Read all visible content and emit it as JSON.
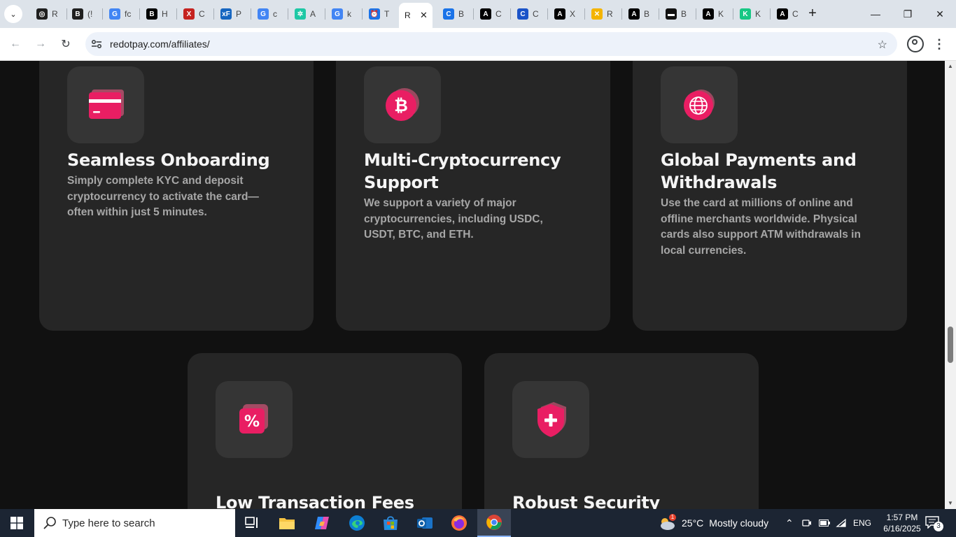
{
  "browser": {
    "tabs": [
      {
        "short": "R",
        "fav_color": "#1f1f1f",
        "fav_glyph": "◎"
      },
      {
        "short": "(!",
        "fav_color": "#1f1f1f",
        "fav_glyph": "B"
      },
      {
        "short": "fc",
        "fav_color": "#4285f4",
        "fav_glyph": "G"
      },
      {
        "short": "H",
        "fav_color": "#000000",
        "fav_glyph": "B"
      },
      {
        "short": "C",
        "fav_color": "#c5221f",
        "fav_glyph": "X"
      },
      {
        "short": "P",
        "fav_color": "#1565c0",
        "fav_glyph": "xF"
      },
      {
        "short": "c",
        "fav_color": "#4285f4",
        "fav_glyph": "G"
      },
      {
        "short": "A",
        "fav_color": "#1ec8a5",
        "fav_glyph": "✲"
      },
      {
        "short": "k",
        "fav_color": "#4285f4",
        "fav_glyph": "G"
      },
      {
        "short": "T",
        "fav_color": "#1a73e8",
        "fav_glyph": "⏰"
      },
      {
        "short": "R",
        "fav_color": "#ffffff",
        "fav_glyph": "",
        "active": true
      },
      {
        "short": "B",
        "fav_color": "#1a73e8",
        "fav_glyph": "C"
      },
      {
        "short": "C",
        "fav_color": "#000000",
        "fav_glyph": "A"
      },
      {
        "short": "C",
        "fav_color": "#1a53c8",
        "fav_glyph": "C"
      },
      {
        "short": "X",
        "fav_color": "#000000",
        "fav_glyph": "A"
      },
      {
        "short": "R",
        "fav_color": "#f4b400",
        "fav_glyph": "✕"
      },
      {
        "short": "B",
        "fav_color": "#000000",
        "fav_glyph": "A"
      },
      {
        "short": "B",
        "fav_color": "#111111",
        "fav_glyph": "▬"
      },
      {
        "short": "K",
        "fav_color": "#000000",
        "fav_glyph": "A"
      },
      {
        "short": "K",
        "fav_color": "#16c784",
        "fav_glyph": "K"
      },
      {
        "short": "C",
        "fav_color": "#000000",
        "fav_glyph": "A"
      }
    ],
    "address": "redotpay.com/affiliates/"
  },
  "page": {
    "cards": [
      {
        "title": "Seamless Onboarding",
        "desc": "Simply complete KYC and deposit cryptocurrency to activate the card—often within just 5 minutes.",
        "icon": "credit-card-icon"
      },
      {
        "title": "Multi-Cryptocurrency Support",
        "desc": "We support a variety of major cryptocurrencies, including USDC, USDT, BTC, and ETH.",
        "icon": "bitcoin-icon"
      },
      {
        "title": "Global Payments and Withdrawals",
        "desc": "Use the card at millions of online and offline merchants worldwide. Physical cards also support ATM withdrawals in local currencies.",
        "icon": "globe-icon"
      },
      {
        "title": "Low Transaction Fees",
        "desc": "",
        "icon": "percent-icon"
      },
      {
        "title": "Robust Security",
        "desc": "",
        "icon": "shield-plus-icon"
      }
    ],
    "accent": "#e91e63"
  },
  "taskbar": {
    "search_placeholder": "Type here to search",
    "weather_temp": "25°C",
    "weather_desc": "Mostly cloudy",
    "weather_badge": "1",
    "lang": "ENG",
    "time": "1:57 PM",
    "date": "6/16/2025",
    "notif_count": "3"
  }
}
